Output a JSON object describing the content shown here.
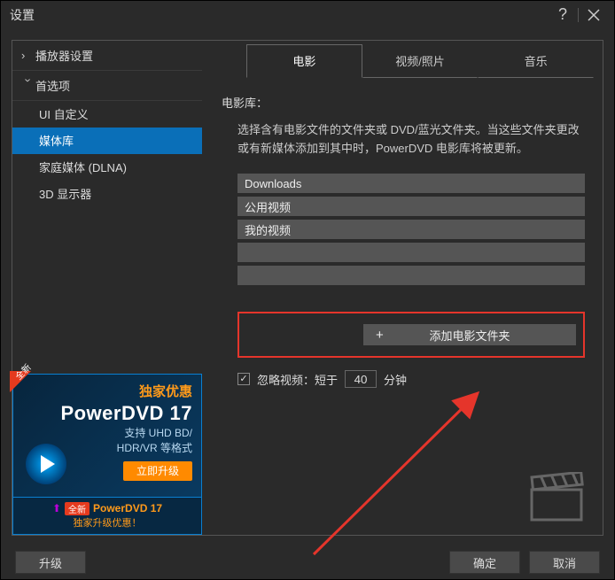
{
  "titlebar": {
    "title": "设置"
  },
  "sidebar": {
    "group_player": "播放器设置",
    "group_pref": "首选项",
    "items": {
      "ui": "UI 自定义",
      "media": "媒体库",
      "dlna": "家庭媒体 (DLNA)",
      "display3d": "3D 显示器"
    }
  },
  "promo": {
    "badge": "全新",
    "exclusive": "独家优惠",
    "title": "PowerDVD 17",
    "sub1": "支持 UHD BD/",
    "sub2": "HDR/VR 等格式",
    "btn": "立即升级",
    "bot_badge": "全新",
    "bot_brand": "PowerDVD 17",
    "bot_line2": "独家升级优惠！"
  },
  "tabs": {
    "movie": "电影",
    "video": "视频/照片",
    "music": "音乐"
  },
  "content": {
    "section": "电影库：",
    "desc": "选择含有电影文件的文件夹或 DVD/蓝光文件夹。当这些文件夹更改或有新媒体添加到其中时，PowerDVD 电影库将被更新。",
    "folders": [
      "Downloads",
      "公用视频",
      "我的视频"
    ],
    "add_btn": "添加电影文件夹",
    "ignore_label_pre": "忽略视频：短于",
    "ignore_value": "40",
    "ignore_label_post": "分钟"
  },
  "footer": {
    "upgrade": "升级",
    "ok": "确定",
    "cancel": "取消"
  }
}
